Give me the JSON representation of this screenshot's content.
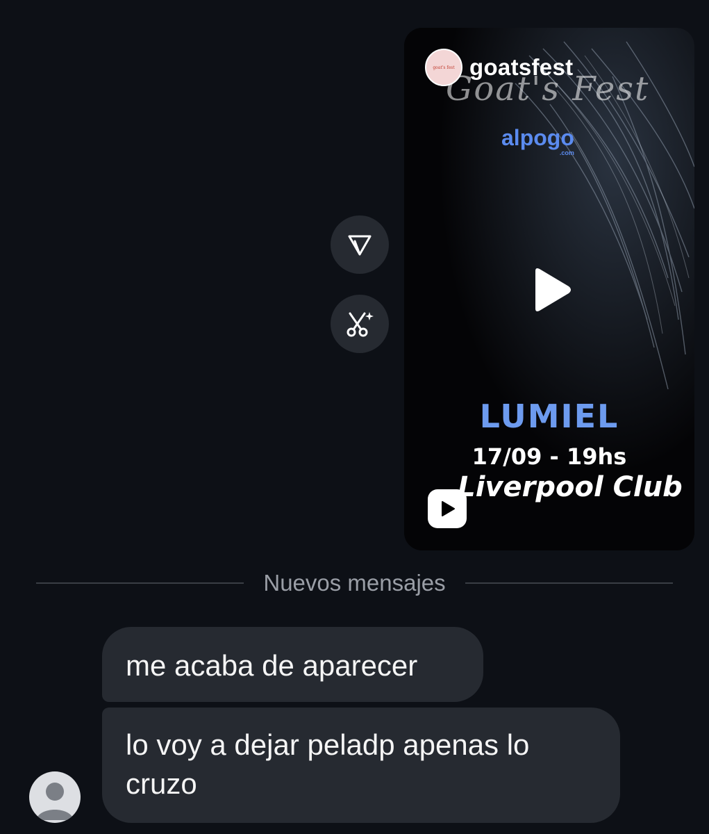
{
  "reel": {
    "username": "goatsfest",
    "avatar_text": "goat's fest",
    "script_title": "Goat's Fest",
    "sponsor": "alpogo",
    "sponsor_suffix": ".com",
    "artist": "LUMIEL",
    "date_time": "17/09 - 19hs",
    "venue": "Liverpool Club"
  },
  "actions": {
    "share_icon": "send-icon",
    "remix_icon": "scissors-sparkle-icon"
  },
  "divider": {
    "label": "Nuevos mensajes"
  },
  "messages": [
    {
      "text": "me acaba de aparecer"
    },
    {
      "text": "lo voy a dejar peladp apenas lo cruzo"
    }
  ],
  "colors": {
    "background": "#0d1016",
    "bubble": "#262a31",
    "accent_blue": "#6d9bef"
  }
}
